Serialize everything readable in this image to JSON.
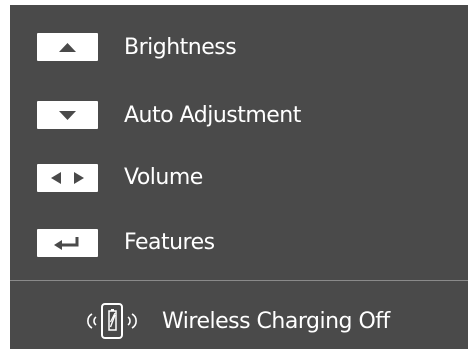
{
  "menu": {
    "items": [
      {
        "key_icon": "arrow-up-icon",
        "label": "Brightness"
      },
      {
        "key_icon": "arrow-down-icon",
        "label": "Auto Adjustment"
      },
      {
        "key_icon": "arrow-left-right-icon",
        "label": "Volume"
      },
      {
        "key_icon": "enter-return-icon",
        "label": "Features"
      }
    ],
    "wireless": {
      "icon": "wireless-charging-icon",
      "label": "Wireless Charging Off"
    }
  },
  "colors": {
    "panel_background": "#4a4a4a",
    "text": "#ffffff",
    "keycap": "#ffffff",
    "keycap_glyph": "#4a4a4a",
    "divider": "#8a8a8a"
  }
}
